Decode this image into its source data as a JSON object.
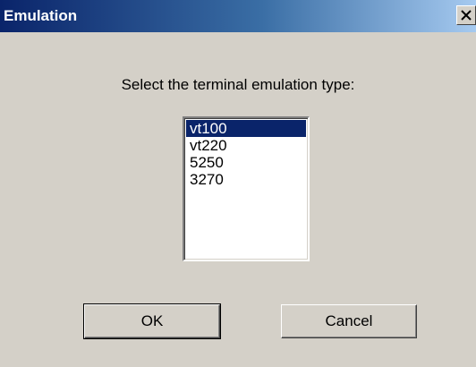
{
  "window": {
    "title": "Emulation"
  },
  "prompt": "Select the terminal emulation type:",
  "emulation_list": {
    "items": [
      "vt100",
      "vt220",
      "5250",
      "3270"
    ],
    "selected": "vt100"
  },
  "buttons": {
    "ok_label": "OK",
    "cancel_label": "Cancel"
  },
  "icons": {
    "close": "close-icon"
  },
  "colors": {
    "titlebar_start": "#0a246a",
    "titlebar_end": "#a6caf0",
    "face": "#d4d0c8",
    "selection": "#0a246a"
  }
}
